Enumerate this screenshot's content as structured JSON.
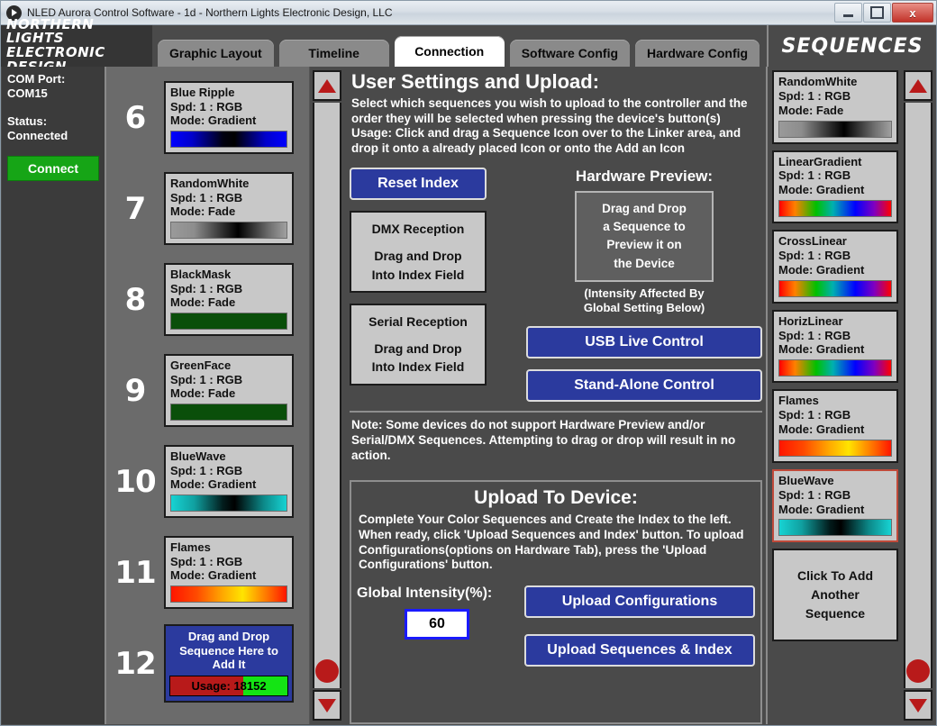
{
  "window": {
    "title": "NLED Aurora Control Software - 1d - Northern Lights Electronic Design, LLC",
    "minimize_label": "–",
    "maximize_label": "□",
    "close_label": "x"
  },
  "logo": {
    "line1": "NORTHERN LIGHTS",
    "line2": "ELECTRONIC DESIGN"
  },
  "tabs": [
    {
      "label": "Graphic Layout",
      "active": false
    },
    {
      "label": "Timeline",
      "active": false
    },
    {
      "label": "Connection",
      "active": true
    },
    {
      "label": "Software Config",
      "active": false
    },
    {
      "label": "Hardware Config",
      "active": false
    }
  ],
  "sequences_header": "SEQUENCES",
  "com_panel": {
    "port_label": "COM Port:",
    "port_value": "COM15",
    "status_label": "Status:",
    "status_value": "Connected",
    "connect_button": "Connect",
    "connect_color": "#16a516"
  },
  "index_list": [
    {
      "number": "6",
      "name": "Blue Ripple",
      "speed": "Spd: 1 : RGB",
      "mode": "Mode: Gradient",
      "gradient": "linear-gradient(90deg,#0000ff 0%,#0000cc 18%,#000010 45%,#000000 55%,#0000cc 82%,#0000ff 100%)"
    },
    {
      "number": "7",
      "name": "RandomWhite",
      "speed": "Spd: 1 : RGB",
      "mode": "Mode: Fade",
      "gradient": "linear-gradient(90deg,#9a9a9a 0%,#8d8d8d 20%,#2a2a2a 46%,#000000 58%,#6e6e6e 85%,#a0a0a0 100%)"
    },
    {
      "number": "8",
      "name": "BlackMask",
      "speed": "Spd: 1 : RGB",
      "mode": "Mode: Fade",
      "gradient": "linear-gradient(90deg,#0a4f0a,#0a4f0a)"
    },
    {
      "number": "9",
      "name": "GreenFace",
      "speed": "Spd: 1 : RGB",
      "mode": "Mode: Fade",
      "gradient": "linear-gradient(90deg,#0a4f0a,#0a4f0a)"
    },
    {
      "number": "10",
      "name": "BlueWave",
      "speed": "Spd: 1 : RGB",
      "mode": "Mode: Gradient",
      "gradient": "linear-gradient(90deg,#17d3d3 0%,#10a0a0 20%,#021c1c 45%,#000000 55%,#0c8888 80%,#17d3d3 100%)"
    },
    {
      "number": "11",
      "name": "Flames",
      "speed": "Spd: 1 : RGB",
      "mode": "Mode: Gradient",
      "gradient": "linear-gradient(90deg,#ff1500 0%,#ff4a00 22%,#ffaa00 45%,#ffe400 62%,#ff6a00 85%,#ff1500 100%)"
    }
  ],
  "add_slot": {
    "number": "12",
    "line1": "Drag and Drop",
    "line2": "Sequence Here to",
    "line3": "Add It",
    "usage_text": "Usage: 18152",
    "usage_fill_percent": 62,
    "usage_fill_color": "#b81a1a",
    "usage_bg_color": "#14e414",
    "bg_color": "#2b3a9e"
  },
  "main": {
    "title": "User Settings and Upload:",
    "description": "Select which sequences you wish to upload to the controller and the order they will be selected when pressing the device's button(s)",
    "usage_line": "Usage: Click and drag a Sequence Icon over to the Linker area, and drop it onto a already placed Icon or onto the Add an Icon",
    "reset_index_button": "Reset Index",
    "dmx_box": {
      "title": "DMX Reception",
      "line1": "Drag and Drop",
      "line2": "Into Index Field"
    },
    "serial_box": {
      "title": "Serial Reception",
      "line1": "Drag and Drop",
      "line2": "Into Index Field"
    },
    "hardware_preview": {
      "label": "Hardware Preview:",
      "drop_line1": "Drag and Drop",
      "drop_line2": "a Sequence to",
      "drop_line3": "Preview it on",
      "drop_line4": "the Device",
      "note_line1": "(Intensity Affected By",
      "note_line2": "Global Setting Below)"
    },
    "usb_live_button": "USB Live Control",
    "standalone_button": "Stand-Alone Control",
    "note": "Note: Some devices do not support Hardware Preview and/or Serial/DMX Sequences. Attempting to drag or drop will result in no action.",
    "accent_blue": "#2b3a9e"
  },
  "upload": {
    "title": "Upload To Device:",
    "description": "Complete Your Color Sequences and Create the Index to the left. When ready, click 'Upload Sequences and Index' button. To upload Configurations(options on Hardware Tab), press the 'Upload Configurations' button.",
    "intensity_label": "Global Intensity(%):",
    "intensity_value": "60",
    "upload_config_button": "Upload Configurations",
    "upload_sequences_button": "Upload Sequences & Index"
  },
  "sequences_panel": [
    {
      "name": "RandomWhite",
      "speed": "Spd: 1 : RGB",
      "mode": "Mode: Fade",
      "selected": false,
      "gradient": "linear-gradient(90deg,#9a9a9a 0%,#8d8d8d 20%,#2a2a2a 46%,#000000 58%,#6e6e6e 85%,#a0a0a0 100%)"
    },
    {
      "name": "LinearGradient",
      "speed": "Spd: 1 : RGB",
      "mode": "Mode: Gradient",
      "selected": false,
      "gradient": "linear-gradient(90deg,#ff0000 0%,#ff8000 14%,#00c000 33%,#00b0b0 48%,#0000ff 68%,#8000c0 85%,#ff0000 100%)"
    },
    {
      "name": "CrossLinear",
      "speed": "Spd: 1 : RGB",
      "mode": "Mode: Gradient",
      "selected": false,
      "gradient": "linear-gradient(90deg,#ff0000 0%,#ff8000 14%,#00c000 33%,#00b0b0 48%,#0000ff 68%,#8000c0 85%,#ff0000 100%)"
    },
    {
      "name": "HorizLinear",
      "speed": "Spd: 1 : RGB",
      "mode": "Mode: Gradient",
      "selected": false,
      "gradient": "linear-gradient(90deg,#ff0000 0%,#ff8000 14%,#00c000 33%,#00b0b0 48%,#0000ff 68%,#8000c0 85%,#ff0000 100%)"
    },
    {
      "name": "Flames",
      "speed": "Spd: 1 : RGB",
      "mode": "Mode: Gradient",
      "selected": false,
      "gradient": "linear-gradient(90deg,#ff1500 0%,#ff4a00 22%,#ffaa00 45%,#ffe400 62%,#ff6a00 85%,#ff1500 100%)"
    },
    {
      "name": "BlueWave",
      "speed": "Spd: 1 : RGB",
      "mode": "Mode: Gradient",
      "selected": true,
      "gradient": "linear-gradient(90deg,#17d3d3 0%,#10a0a0 20%,#021c1c 45%,#000000 55%,#0c8888 80%,#17d3d3 100%)"
    }
  ],
  "add_sequence_button": {
    "line1": "Click To Add",
    "line2": "Another",
    "line3": "Sequence"
  }
}
